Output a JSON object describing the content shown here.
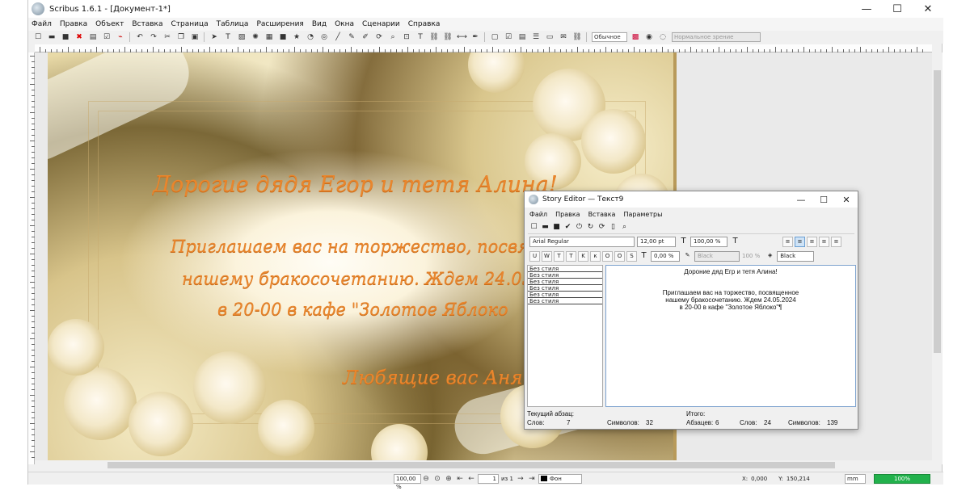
{
  "window": {
    "title": "Scribus 1.6.1 - [Документ-1*]",
    "controls": {
      "minimize": "—",
      "maximize": "☐",
      "close": "✕"
    }
  },
  "menubar": [
    "Файл",
    "Правка",
    "Объект",
    "Вставка",
    "Страница",
    "Таблица",
    "Расширения",
    "Вид",
    "Окна",
    "Сценарии",
    "Справка"
  ],
  "toolbar": {
    "mode_select": "Обычное",
    "vision_select": "Нормальное зрение"
  },
  "document": {
    "title": "Дорогие дядя Егор и тетя Алина!",
    "line1": "Приглашаем вас на торжество, посвященное",
    "line2": "нашему бракосочетанию. Ждем 24.05.2024",
    "line3": "в 20-00 в кафе \"Золотое Яблоко",
    "signature": "Любящие вас Аня и ..."
  },
  "story_editor": {
    "title": "Story Editor — Текст9",
    "menu": [
      "Файл",
      "Правка",
      "Вставка",
      "Параметры"
    ],
    "font": "Arial Regular",
    "size": "12,00 pt",
    "scale": "100,00 %",
    "char_spacing": "0,00 %",
    "stroke_color": "Black",
    "stroke_shade": "100 %",
    "fill_color": "Black",
    "styles": [
      "Без стиля",
      "Без стиля",
      "Без стиля",
      "Без стиля",
      "Без стиля",
      "Без стиля"
    ],
    "text": {
      "p1": "Дороние дяд Егр и тетя Алина!",
      "p2": "Приглашаем вас на торжество, посвященное",
      "p3": "нашему бракосочетанию. Ждем 24.05.2024",
      "p4": "в 20-00 в кафе \"Золотое Яблоко\"¶"
    },
    "status": {
      "current_label": "Текущий абзац:",
      "total_label": "Итого:",
      "words_label": "Слов:",
      "words_value": "7",
      "chars_label": "Символов:",
      "chars_value": "32",
      "paragraphs_label": "Абзацев:",
      "paragraphs_value": "6",
      "total_words_label": "Слов:",
      "total_words_value": "24",
      "total_chars_label": "Символов:",
      "total_chars_value": "139"
    }
  },
  "statusbar": {
    "zoom": "100,00 %",
    "page": "1",
    "page_of": "из 1",
    "layer": "Фон",
    "x_label": "X:",
    "x_value": "0,000",
    "y_label": "Y:",
    "y_value": "150,214",
    "unit": "mm",
    "progress_label": "100%",
    "progress": 1.0
  }
}
